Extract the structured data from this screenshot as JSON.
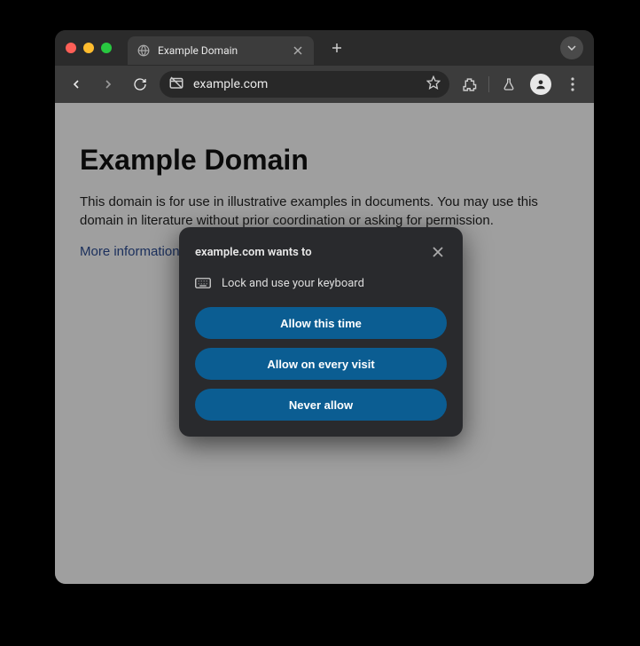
{
  "tab": {
    "title": "Example Domain"
  },
  "toolbar": {
    "url": "example.com"
  },
  "page": {
    "heading": "Example Domain",
    "paragraph": "This domain is for use in illustrative examples in documents. You may use this domain in literature without prior coordination or asking for permission.",
    "link": "More information..."
  },
  "permission": {
    "title": "example.com wants to",
    "request": "Lock and use your keyboard",
    "allow_once": "Allow this time",
    "allow_every": "Allow on every visit",
    "never": "Never allow"
  }
}
